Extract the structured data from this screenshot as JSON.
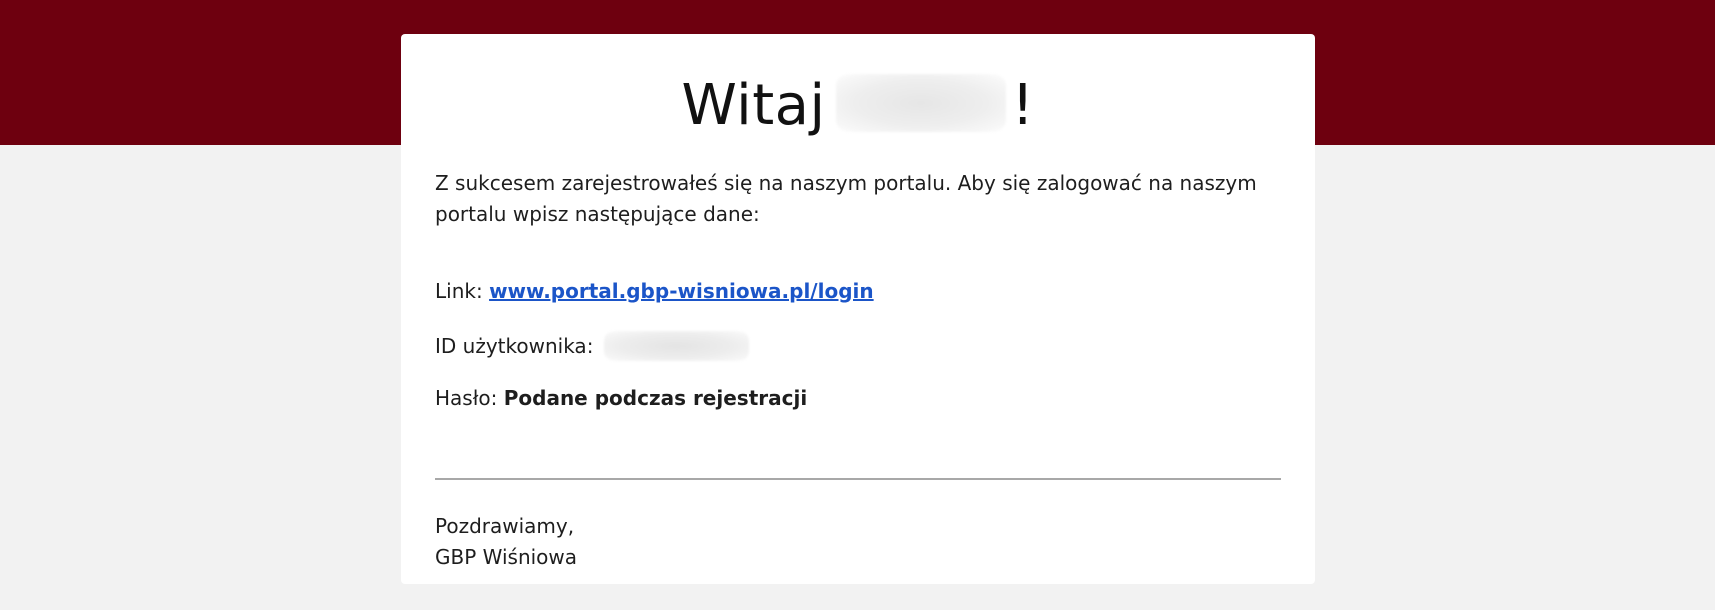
{
  "colors": {
    "header_band": "#6e000f",
    "page_background": "#f2f2f2",
    "card_background": "#ffffff",
    "link": "#1b55c8",
    "divider": "#a8a8a8"
  },
  "email": {
    "greeting_word": "Witaj",
    "greeting_suffix": "!",
    "intro": "Z sukcesem zarejestrowałeś się na naszym portalu. Aby się zalogować na naszym portalu wpisz następujące dane:",
    "link_label": "Link:",
    "link_text": "www.portal.gbp-wisniowa.pl/login",
    "user_id_label": "ID użytkownika:",
    "password_label": "Hasło:",
    "password_value": "Podane podczas rejestracji",
    "closing_line": "Pozdrawiamy,",
    "signature": "GBP Wiśniowa"
  }
}
